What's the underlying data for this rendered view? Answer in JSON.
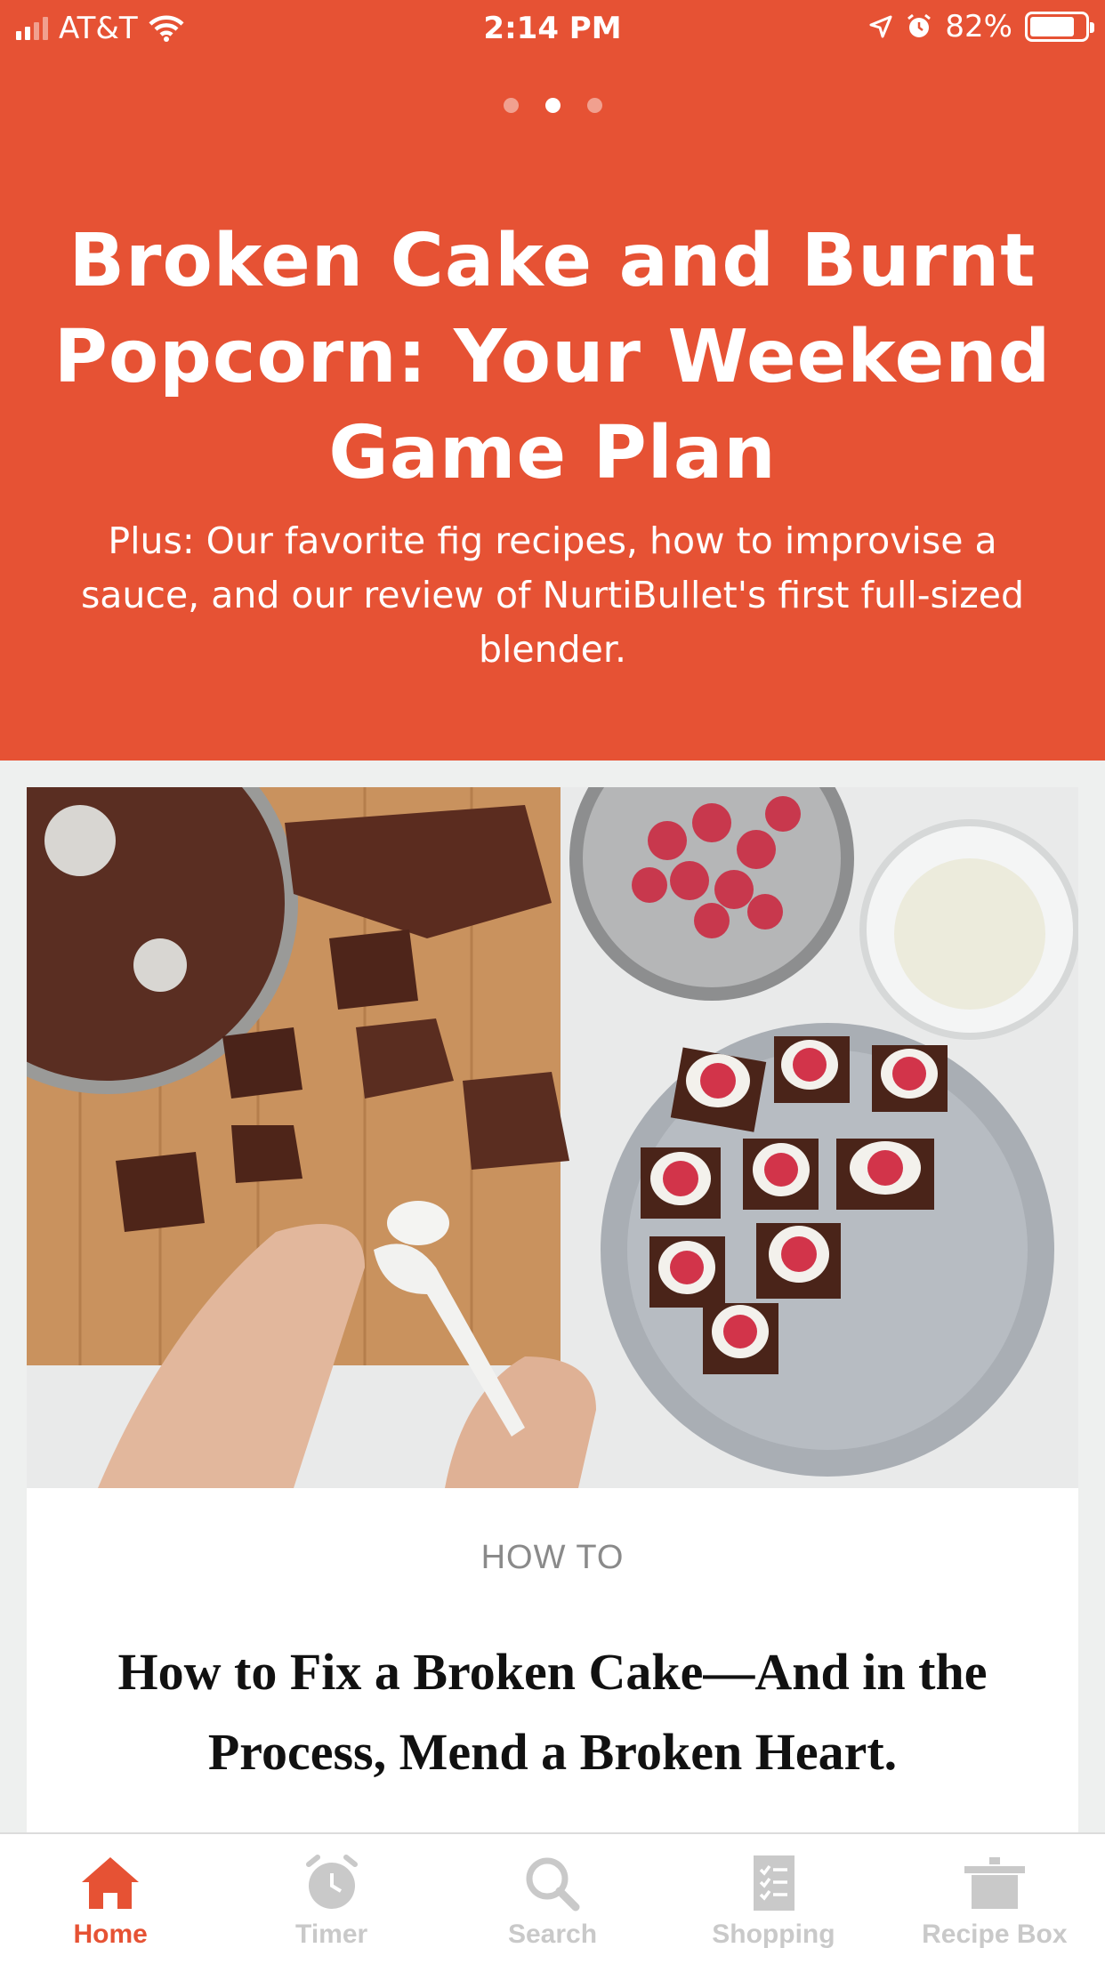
{
  "status_bar": {
    "carrier": "AT&T",
    "time": "2:14 PM",
    "battery": "82%",
    "battery_level": 0.82
  },
  "carousel": {
    "page_count": 3,
    "active_index": 1
  },
  "hero": {
    "title": "Broken Cake and Burnt Popcorn: Your Weekend Game Plan",
    "subtitle": "Plus: Our favorite fig recipes, how to improvise a sauce, and our review of NurtiBullet's first full-sized blender.",
    "background_color": "#e65234"
  },
  "article": {
    "image_icon": "cake-photo",
    "category": "HOW TO",
    "title": "How to Fix a Broken Cake—And in the Process, Mend a Broken Heart."
  },
  "tabbar": {
    "accent_color": "#e65234",
    "inactive_color": "#c9c9c9",
    "tabs": [
      {
        "label": "Home",
        "icon": "home-icon",
        "active": true
      },
      {
        "label": "Timer",
        "icon": "timer-icon",
        "active": false
      },
      {
        "label": "Search",
        "icon": "search-icon",
        "active": false
      },
      {
        "label": "Shopping",
        "icon": "shopping-list-icon",
        "active": false
      },
      {
        "label": "Recipe Box",
        "icon": "pot-icon",
        "active": false
      }
    ]
  }
}
